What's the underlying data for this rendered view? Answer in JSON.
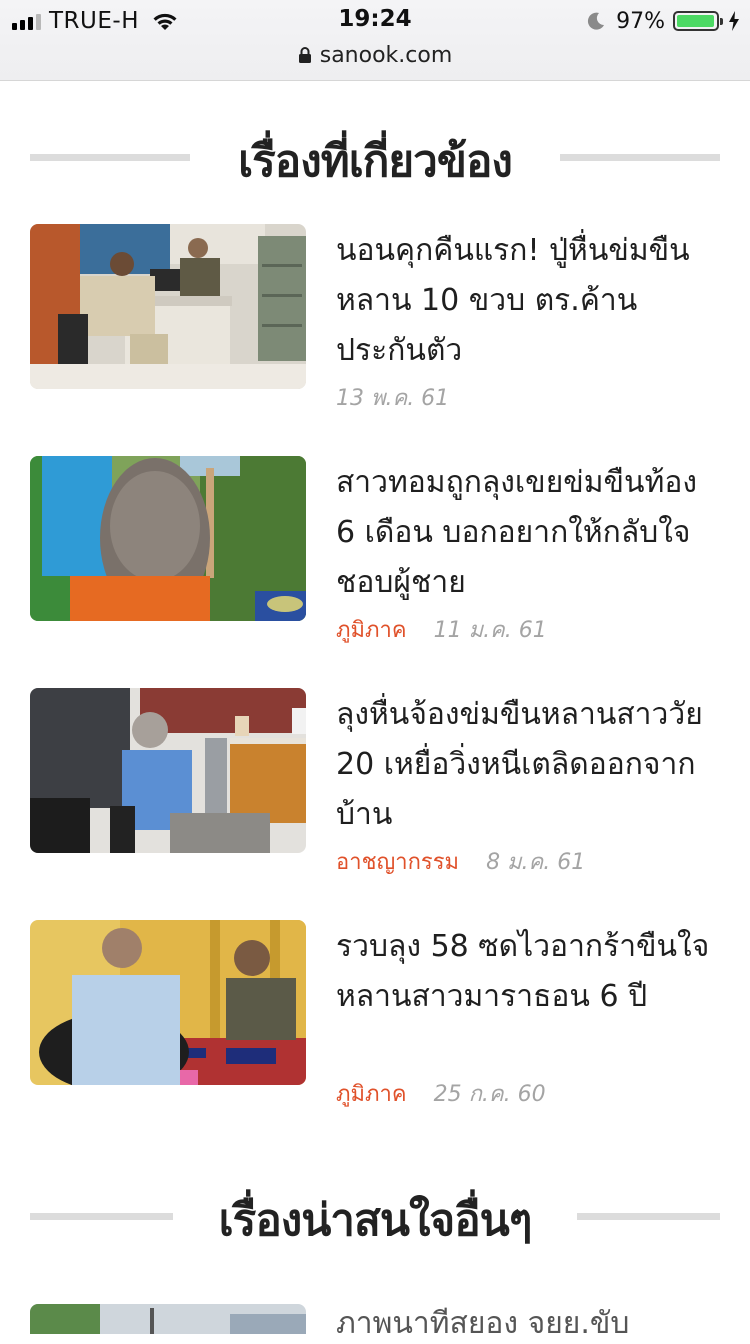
{
  "status_bar": {
    "carrier": "TRUE-H",
    "time": "19:24",
    "battery": "97%",
    "battery_level": 0.97,
    "url": "sanook.com",
    "icons": [
      "signal-icon",
      "wifi-icon",
      "moon-icon",
      "battery-icon",
      "charging-icon",
      "lock-icon"
    ]
  },
  "related": {
    "title": "เรื่องที่เกี่ยวข้อง",
    "articles": [
      {
        "headline": "นอนคุกคืนแรก! ปู่หื่นข่มขืนหลาน 10 ขวบ ตร.ค้านประกันตัว",
        "category": "",
        "date": "13 พ.ค. 61"
      },
      {
        "headline": "สาวทอมถูกลุงเขยข่มขืนท้อง 6 เดือน บอกอยากให้กลับใจชอบผู้ชาย",
        "category": "ภูมิภาค",
        "date": "11 ม.ค. 61"
      },
      {
        "headline": "ลุงหื่นจ้องข่มขืนหลานสาววัย 20 เหยื่อวิ่งหนีเตลิดออกจากบ้าน",
        "category": "อาชญากรรม",
        "date": "8 ม.ค. 61"
      },
      {
        "headline": "รวบลุง 58 ซดไวอากร้าขืนใจหลานสาวมาราธอน 6 ปี",
        "category": "ภูมิภาค",
        "date": "25 ก.ค. 60"
      }
    ]
  },
  "other": {
    "title": "เรื่องน่าสนใจอื่นๆ",
    "partial_headline": "ภาพนาทีสยอง จยย.ขับ"
  },
  "colors": {
    "category": "#e0512a",
    "date": "#a4a4a4",
    "divider": "#dcdcdc"
  }
}
